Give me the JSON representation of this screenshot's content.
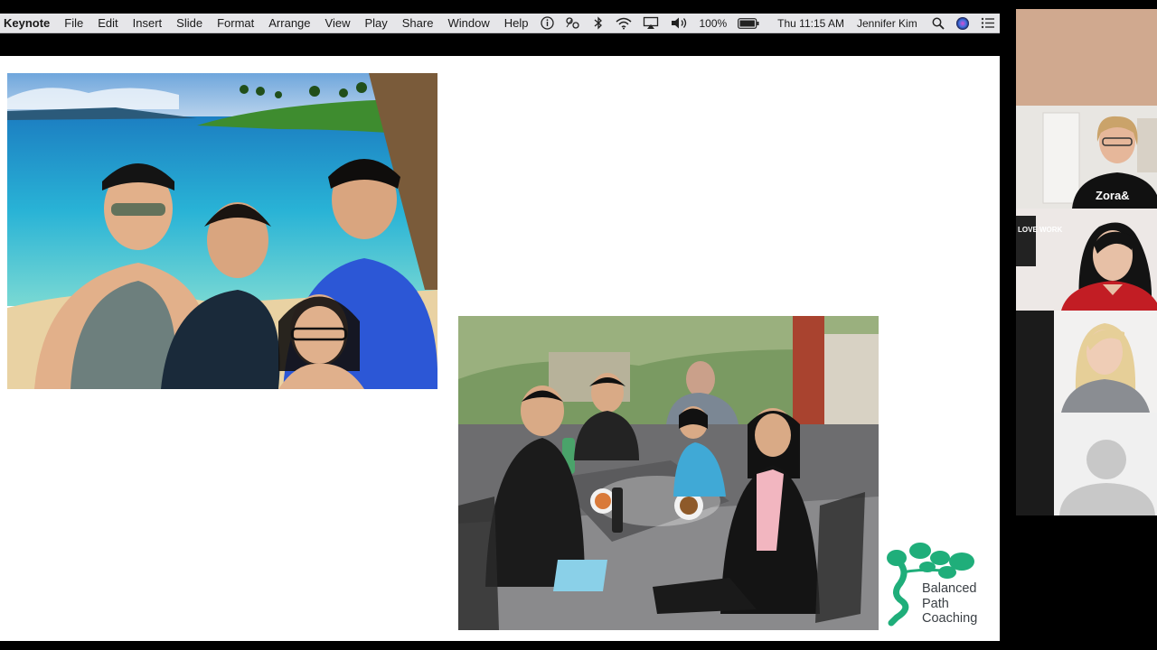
{
  "menubar": {
    "app_name": "Keynote",
    "menus": [
      "File",
      "Edit",
      "Insert",
      "Slide",
      "Format",
      "Arrange",
      "View",
      "Play",
      "Share",
      "Window",
      "Help"
    ],
    "status_icons": [
      "info-icon",
      "activity-monitor-icon",
      "bluetooth-icon",
      "wifi-icon",
      "airplay-icon",
      "volume-icon"
    ],
    "battery": "100%",
    "clock": "Thu 11:15 AM",
    "user": "Jennifer Kim"
  },
  "slide": {
    "photos": [
      "family beach photo",
      "family dinner photo"
    ],
    "logo": {
      "line1": "Balanced",
      "line2": "Path",
      "line3": "Coaching",
      "color": "#1fae7a"
    }
  },
  "gallery": {
    "participants": [
      {
        "shirt_text": "Zora&"
      },
      {
        "poster_text": "LOVE WORK"
      },
      {},
      {}
    ]
  }
}
